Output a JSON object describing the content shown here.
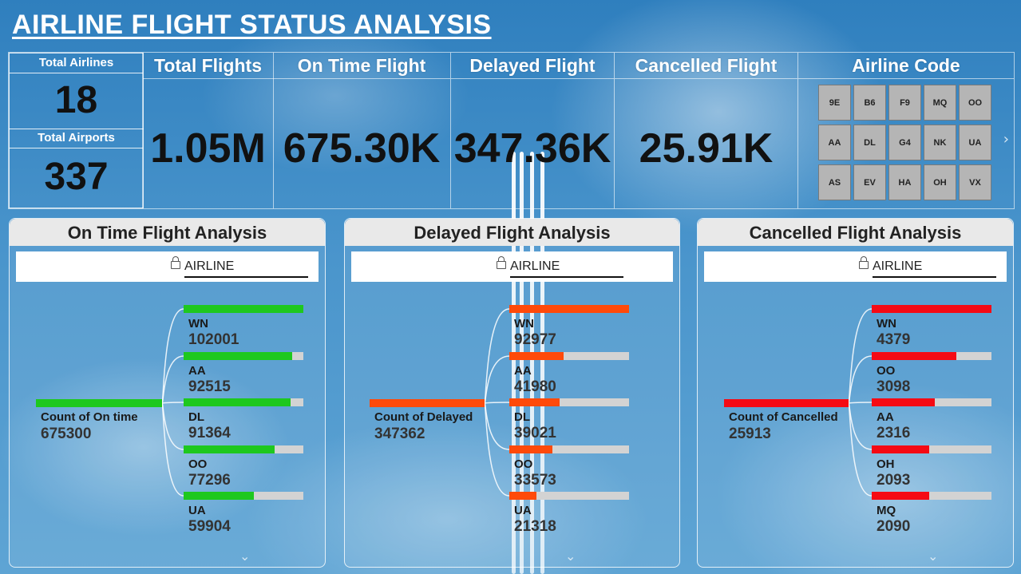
{
  "title": "AIRLINE FLIGHT STATUS ANALYSIS",
  "kpis": {
    "total_airlines_label": "Total Airlines",
    "total_airlines_value": "18",
    "total_airports_label": "Total Airports",
    "total_airports_value": "337",
    "total_flights_label": "Total Flights",
    "total_flights_value": "1.05M",
    "on_time_label": "On Time Flight",
    "on_time_value": "675.30K",
    "delayed_label": "Delayed Flight",
    "delayed_value": "347.36K",
    "cancelled_label": "Cancelled Flight",
    "cancelled_value": "25.91K"
  },
  "airline_codes": {
    "label": "Airline Code",
    "codes": [
      "9E",
      "B6",
      "F9",
      "MQ",
      "OO",
      "AA",
      "DL",
      "G4",
      "NK",
      "UA",
      "AS",
      "EV",
      "HA",
      "OH",
      "VX"
    ]
  },
  "panels": [
    {
      "title": "On Time Flight Analysis",
      "filter_label": "AIRLINE",
      "color": "#1ec81e",
      "root_label": "Count of On time",
      "root_value": "675300",
      "nodes": [
        {
          "label": "WN",
          "value": "102001",
          "fraction": 1.0
        },
        {
          "label": "AA",
          "value": "92515",
          "fraction": 0.907
        },
        {
          "label": "DL",
          "value": "91364",
          "fraction": 0.896
        },
        {
          "label": "OO",
          "value": "77296",
          "fraction": 0.758
        },
        {
          "label": "UA",
          "value": "59904",
          "fraction": 0.587
        }
      ]
    },
    {
      "title": "Delayed Flight Analysis",
      "filter_label": "AIRLINE",
      "color": "#ff4a0a",
      "root_label": "Count of Delayed",
      "root_value": "347362",
      "nodes": [
        {
          "label": "WN",
          "value": "92977",
          "fraction": 1.0
        },
        {
          "label": "AA",
          "value": "41980",
          "fraction": 0.452
        },
        {
          "label": "DL",
          "value": "39021",
          "fraction": 0.42
        },
        {
          "label": "OO",
          "value": "33573",
          "fraction": 0.361
        },
        {
          "label": "UA",
          "value": "21318",
          "fraction": 0.229
        }
      ]
    },
    {
      "title": "Cancelled Flight Analysis",
      "filter_label": "AIRLINE",
      "color": "#f50a14",
      "root_label": "Count of Cancelled",
      "root_value": "25913",
      "nodes": [
        {
          "label": "WN",
          "value": "4379",
          "fraction": 1.0
        },
        {
          "label": "OO",
          "value": "3098",
          "fraction": 0.707
        },
        {
          "label": "AA",
          "value": "2316",
          "fraction": 0.529
        },
        {
          "label": "OH",
          "value": "2093",
          "fraction": 0.478
        },
        {
          "label": "MQ",
          "value": "2090",
          "fraction": 0.477
        }
      ]
    }
  ]
}
